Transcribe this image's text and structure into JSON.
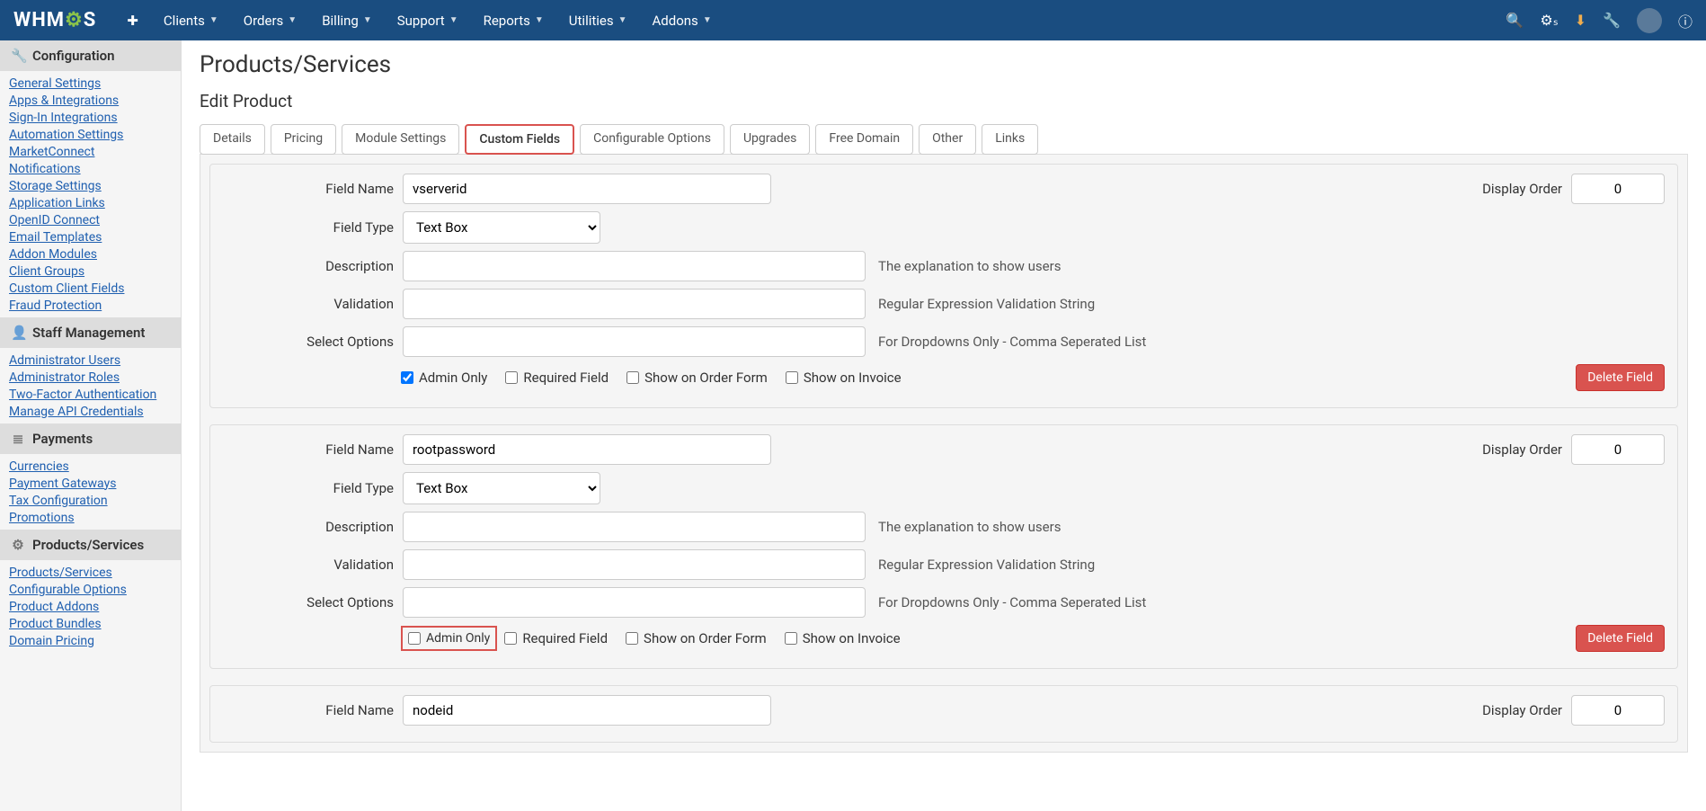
{
  "brand": {
    "name_pre": "WHM",
    "name_post": "S"
  },
  "topnav": {
    "items": [
      "Clients",
      "Orders",
      "Billing",
      "Support",
      "Reports",
      "Utilities",
      "Addons"
    ]
  },
  "sidebar": {
    "groups": [
      {
        "title": "Configuration",
        "icon": "🔧",
        "links": [
          "General Settings",
          "Apps & Integrations",
          "Sign-In Integrations",
          "Automation Settings",
          "MarketConnect",
          "Notifications",
          "Storage Settings",
          "Application Links",
          "OpenID Connect",
          "Email Templates",
          "Addon Modules",
          "Client Groups",
          "Custom Client Fields",
          "Fraud Protection"
        ]
      },
      {
        "title": "Staff Management",
        "icon": "👤",
        "links": [
          "Administrator Users",
          "Administrator Roles",
          "Two-Factor Authentication",
          "Manage API Credentials"
        ]
      },
      {
        "title": "Payments",
        "icon": "≣",
        "links": [
          "Currencies",
          "Payment Gateways",
          "Tax Configuration",
          "Promotions"
        ]
      },
      {
        "title": "Products/Services",
        "icon": "⚙",
        "links": [
          "Products/Services",
          "Configurable Options",
          "Product Addons",
          "Product Bundles",
          "Domain Pricing"
        ]
      }
    ]
  },
  "page": {
    "title": "Products/Services",
    "subtitle": "Edit Product",
    "tabs": [
      "Details",
      "Pricing",
      "Module Settings",
      "Custom Fields",
      "Configurable Options",
      "Upgrades",
      "Free Domain",
      "Other",
      "Links"
    ],
    "active_tab": "Custom Fields"
  },
  "labels": {
    "field_name": "Field Name",
    "display_order": "Display Order",
    "field_type": "Field Type",
    "description": "Description",
    "validation": "Validation",
    "select_options": "Select Options",
    "admin_only": "Admin Only",
    "required": "Required Field",
    "order_form": "Show on Order Form",
    "invoice": "Show on Invoice",
    "delete": "Delete Field",
    "type_selected": "Text Box"
  },
  "hints": {
    "description": "The explanation to show users",
    "validation": "Regular Expression Validation String",
    "select": "For Dropdowns Only - Comma Seperated List"
  },
  "fields": [
    {
      "name": "vserverid",
      "order": "0",
      "admin_checked": true,
      "admin_highlight": false
    },
    {
      "name": "rootpassword",
      "order": "0",
      "admin_checked": false,
      "admin_highlight": true
    },
    {
      "name": "nodeid",
      "order": "0",
      "admin_checked": false,
      "admin_highlight": false
    }
  ]
}
